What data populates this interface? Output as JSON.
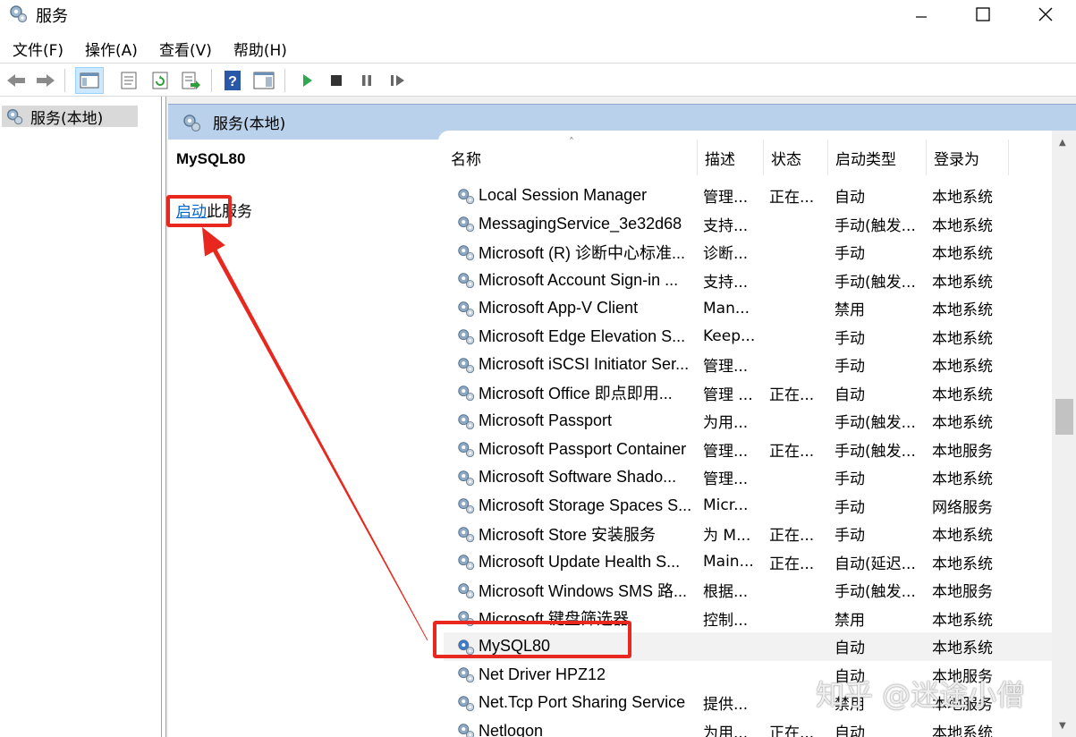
{
  "window": {
    "title": "服务",
    "icon": "gear-icon"
  },
  "menu": [
    "文件(F)",
    "操作(A)",
    "查看(V)",
    "帮助(H)"
  ],
  "toolbar": {
    "icons": [
      "back-arrow-icon",
      "forward-arrow-icon",
      "show-hide-tree-icon",
      "properties-icon",
      "refresh-icon",
      "export-list-icon",
      "help-icon",
      "show-hide-action-pane-icon",
      "start-service-icon",
      "stop-service-icon",
      "pause-service-icon",
      "resume-service-icon"
    ]
  },
  "tree": {
    "root_label": "服务(本地)"
  },
  "pane": {
    "header": "服务(本地)",
    "selected_service": "MySQL80",
    "start_link": "启动",
    "start_suffix": "此服务"
  },
  "table": {
    "columns": [
      "名称",
      "描述",
      "状态",
      "启动类型",
      "登录为"
    ],
    "sorted_column": "名称",
    "rows": [
      {
        "name": "Local Session Manager",
        "desc": "管理...",
        "state": "正在...",
        "startup": "自动",
        "logon": "本地系统"
      },
      {
        "name": "MessagingService_3e32d68",
        "desc": "支持...",
        "state": "",
        "startup": "手动(触发...",
        "logon": "本地系统"
      },
      {
        "name": "Microsoft (R) 诊断中心标准...",
        "desc": "诊断...",
        "state": "",
        "startup": "手动",
        "logon": "本地系统"
      },
      {
        "name": "Microsoft Account Sign-in ...",
        "desc": "支持...",
        "state": "",
        "startup": "手动(触发...",
        "logon": "本地系统"
      },
      {
        "name": "Microsoft App-V Client",
        "desc": "Man...",
        "state": "",
        "startup": "禁用",
        "logon": "本地系统"
      },
      {
        "name": "Microsoft Edge Elevation S...",
        "desc": "Keep...",
        "state": "",
        "startup": "手动",
        "logon": "本地系统"
      },
      {
        "name": "Microsoft iSCSI Initiator Ser...",
        "desc": "管理...",
        "state": "",
        "startup": "手动",
        "logon": "本地系统"
      },
      {
        "name": "Microsoft Office 即点即用...",
        "desc": "管理 ...",
        "state": "正在...",
        "startup": "自动",
        "logon": "本地系统"
      },
      {
        "name": "Microsoft Passport",
        "desc": "为用...",
        "state": "",
        "startup": "手动(触发...",
        "logon": "本地系统"
      },
      {
        "name": "Microsoft Passport Container",
        "desc": "管理...",
        "state": "正在...",
        "startup": "手动(触发...",
        "logon": "本地服务"
      },
      {
        "name": "Microsoft Software Shado...",
        "desc": "管理...",
        "state": "",
        "startup": "手动",
        "logon": "本地系统"
      },
      {
        "name": "Microsoft Storage Spaces S...",
        "desc": "Micr...",
        "state": "",
        "startup": "手动",
        "logon": "网络服务"
      },
      {
        "name": "Microsoft Store 安装服务",
        "desc": "为 M...",
        "state": "正在...",
        "startup": "手动",
        "logon": "本地系统"
      },
      {
        "name": "Microsoft Update Health S...",
        "desc": "Main...",
        "state": "正在...",
        "startup": "自动(延迟...",
        "logon": "本地系统"
      },
      {
        "name": "Microsoft Windows SMS 路...",
        "desc": "根据...",
        "state": "",
        "startup": "手动(触发...",
        "logon": "本地服务"
      },
      {
        "name": "Microsoft 键盘筛选器",
        "desc": "控制...",
        "state": "",
        "startup": "禁用",
        "logon": "本地系统"
      },
      {
        "name": "MySQL80",
        "desc": "",
        "state": "",
        "startup": "自动",
        "logon": "本地系统"
      },
      {
        "name": "Net Driver HPZ12",
        "desc": "",
        "state": "",
        "startup": "自动",
        "logon": "本地服务"
      },
      {
        "name": "Net.Tcp Port Sharing Service",
        "desc": "提供...",
        "state": "",
        "startup": "禁用",
        "logon": "本地服务"
      },
      {
        "name": "Netlogon",
        "desc": "为用...",
        "state": "正在...",
        "startup": "自动",
        "logon": "本地系统"
      }
    ],
    "highlighted_row": 16
  },
  "annotation_color": "#e8281e",
  "watermark": "知乎 @迷途小僧"
}
